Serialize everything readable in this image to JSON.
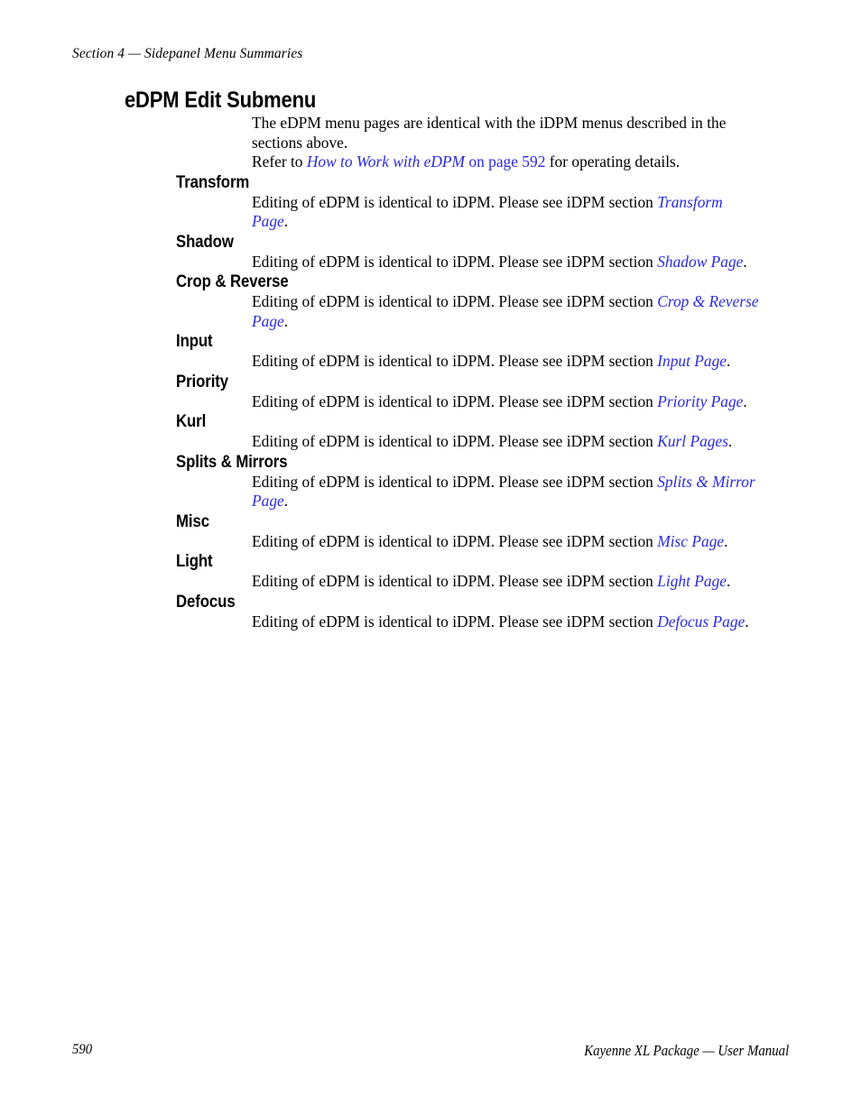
{
  "header": {
    "running_head": "Section 4 — Sidepanel Menu Summaries"
  },
  "title": "eDPM Edit Submenu",
  "intro": {
    "paragraph_1": "The eDPM menu pages are identical with the iDPM menus described in the sections above.",
    "paragraph_2_prefix": "Refer to ",
    "paragraph_2_link_italic": "How to Work with eDPM",
    "paragraph_2_link_plain": " on page 592",
    "paragraph_2_suffix": " for operating details."
  },
  "common": {
    "body_prefix": "Editing of eDPM is identical to iDPM. Please see iDPM section ",
    "body_suffix": "."
  },
  "sections": [
    {
      "heading": "Transform",
      "link": "Transform Page"
    },
    {
      "heading": "Shadow",
      "link": "Shadow Page"
    },
    {
      "heading": "Crop & Reverse",
      "link": "Crop & Reverse Page"
    },
    {
      "heading": "Input",
      "link": "Input Page"
    },
    {
      "heading": "Priority",
      "link": "Priority Page"
    },
    {
      "heading": "Kurl",
      "link": "Kurl Pages"
    },
    {
      "heading": "Splits & Mirrors",
      "link": "Splits & Mirror Page"
    },
    {
      "heading": "Misc",
      "link": "Misc Page"
    },
    {
      "heading": "Light",
      "link": "Light Page"
    },
    {
      "heading": "Defocus",
      "link": "Defocus Page"
    }
  ],
  "footer": {
    "page_number": "590",
    "manual_title": "Kayenne XL Package  —  User Manual"
  },
  "colors": {
    "link": "#2B2BE0",
    "text": "#000000",
    "background": "#ffffff"
  }
}
